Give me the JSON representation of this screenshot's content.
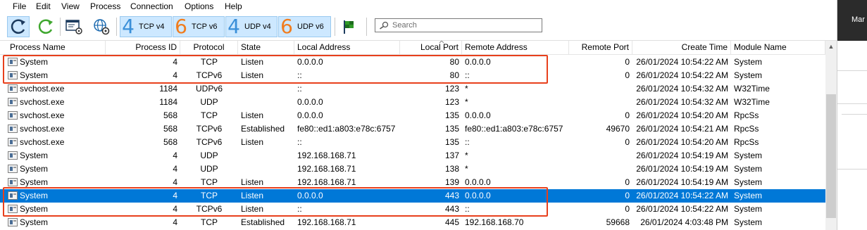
{
  "menu": [
    "File",
    "Edit",
    "View",
    "Process",
    "Connection",
    "Options",
    "Help"
  ],
  "toolbar": {
    "protocols": [
      {
        "num": "4",
        "label": "TCP v4",
        "color": "#3a8fd8"
      },
      {
        "num": "6",
        "label": "TCP v6",
        "color": "#f07c1d"
      },
      {
        "num": "4",
        "label": "UDP v4",
        "color": "#3a8fd8"
      },
      {
        "num": "6",
        "label": "UDP v6",
        "color": "#f07c1d"
      }
    ],
    "search_placeholder": "Search"
  },
  "columns": [
    "Process Name",
    "Process ID",
    "Protocol",
    "State",
    "Local Address",
    "Local Port",
    "Remote Address",
    "Remote Port",
    "Create Time",
    "Module Name"
  ],
  "rows": [
    [
      "System",
      "4",
      "TCP",
      "Listen",
      "0.0.0.0",
      "80",
      "0.0.0.0",
      "0",
      "26/01/2024 10:54:22 AM",
      "System"
    ],
    [
      "System",
      "4",
      "TCPv6",
      "Listen",
      "::",
      "80",
      "::",
      "0",
      "26/01/2024 10:54:22 AM",
      "System"
    ],
    [
      "svchost.exe",
      "1184",
      "UDPv6",
      "",
      "::",
      "123",
      "*",
      "",
      "26/01/2024 10:54:32 AM",
      "W32Time"
    ],
    [
      "svchost.exe",
      "1184",
      "UDP",
      "",
      "0.0.0.0",
      "123",
      "*",
      "",
      "26/01/2024 10:54:32 AM",
      "W32Time"
    ],
    [
      "svchost.exe",
      "568",
      "TCP",
      "Listen",
      "0.0.0.0",
      "135",
      "0.0.0.0",
      "0",
      "26/01/2024 10:54:20 AM",
      "RpcSs"
    ],
    [
      "svchost.exe",
      "568",
      "TCPv6",
      "Established",
      "fe80::ed1:a803:e78c:6757",
      "135",
      "fe80::ed1:a803:e78c:6757",
      "49670",
      "26/01/2024 10:54:21 AM",
      "RpcSs"
    ],
    [
      "svchost.exe",
      "568",
      "TCPv6",
      "Listen",
      "::",
      "135",
      "::",
      "0",
      "26/01/2024 10:54:20 AM",
      "RpcSs"
    ],
    [
      "System",
      "4",
      "UDP",
      "",
      "192.168.168.71",
      "137",
      "*",
      "",
      "26/01/2024 10:54:19 AM",
      "System"
    ],
    [
      "System",
      "4",
      "UDP",
      "",
      "192.168.168.71",
      "138",
      "*",
      "",
      "26/01/2024 10:54:19 AM",
      "System"
    ],
    [
      "System",
      "4",
      "TCP",
      "Listen",
      "192.168.168.71",
      "139",
      "0.0.0.0",
      "0",
      "26/01/2024 10:54:19 AM",
      "System"
    ],
    [
      "System",
      "4",
      "TCP",
      "Listen",
      "0.0.0.0",
      "443",
      "0.0.0.0",
      "0",
      "26/01/2024 10:54:22 AM",
      "System"
    ],
    [
      "System",
      "4",
      "TCPv6",
      "Listen",
      "::",
      "443",
      "::",
      "0",
      "26/01/2024 10:54:22 AM",
      "System"
    ],
    [
      "System",
      "4",
      "TCP",
      "Established",
      "192.168.168.71",
      "445",
      "192.168.168.70",
      "59668",
      "26/01/2024 4:03:48 PM",
      "System"
    ]
  ],
  "selected_row": 10,
  "right_panel_text": "Mar",
  "colors": {
    "selection": "#0078d7",
    "highlight_box": "#e8401c",
    "toolbar_pressed": "#cde8ff"
  }
}
